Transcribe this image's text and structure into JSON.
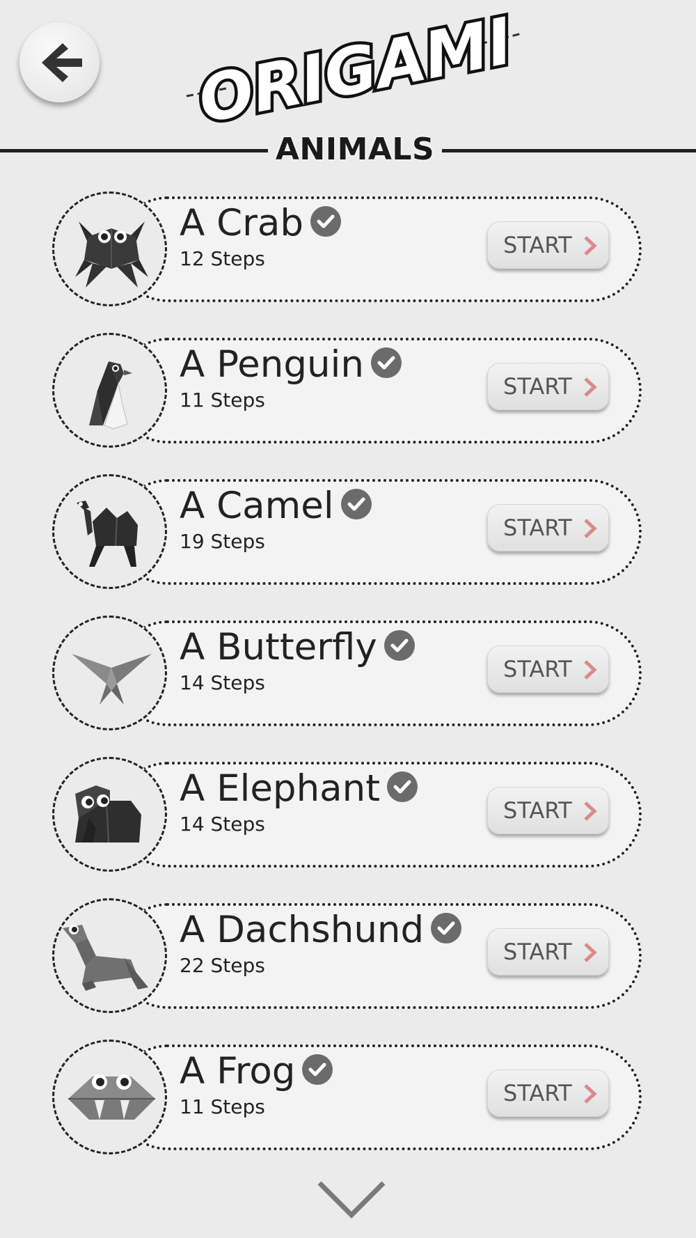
{
  "header": {
    "logo_text": "ORIGAMI",
    "section_title": "ANIMALS"
  },
  "icons": {
    "back": "back-arrow-icon",
    "verified": "check-circle-icon",
    "start_chevron": "chevron-right-icon",
    "scroll": "chevron-down-icon"
  },
  "colors": {
    "background": "#ebebeb",
    "accent_chevron": "#d98a8a",
    "text": "#222222"
  },
  "items": [
    {
      "title": "A Crab",
      "steps": "12 Steps",
      "button": "START",
      "completed": true
    },
    {
      "title": "A Penguin",
      "steps": "11 Steps",
      "button": "START",
      "completed": true
    },
    {
      "title": "A Camel",
      "steps": "19 Steps",
      "button": "START",
      "completed": true
    },
    {
      "title": "A Butterfly",
      "steps": "14 Steps",
      "button": "START",
      "completed": true
    },
    {
      "title": "A Elephant",
      "steps": "14 Steps",
      "button": "START",
      "completed": true
    },
    {
      "title": "A Dachshund",
      "steps": "22 Steps",
      "button": "START",
      "completed": true
    },
    {
      "title": "A Frog",
      "steps": "11 Steps",
      "button": "START",
      "completed": true
    }
  ]
}
